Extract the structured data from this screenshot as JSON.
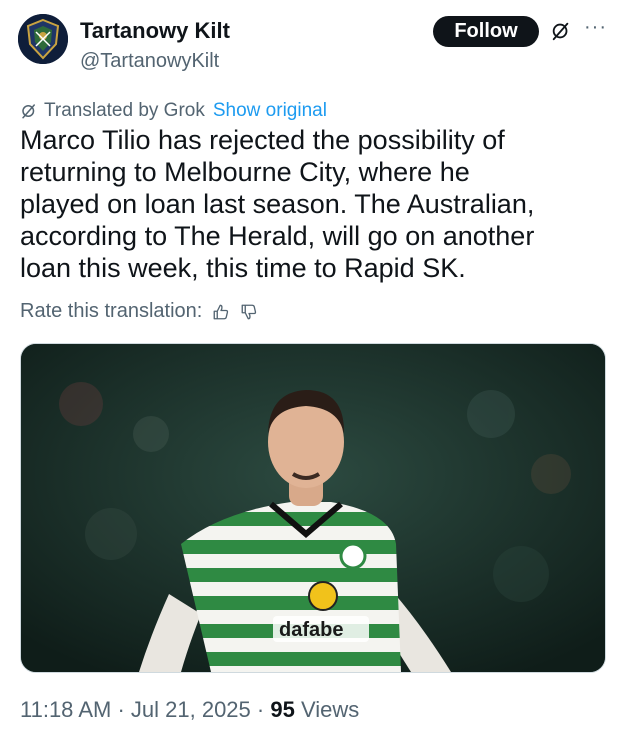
{
  "author": {
    "display_name": "Tartanowy Kilt",
    "handle": "@TartanowyKilt",
    "avatar_icon": "club-crest-icon"
  },
  "actions": {
    "follow_label": "Follow",
    "grok_icon": "grok-icon",
    "more_icon": "more-icon",
    "more_label": "···"
  },
  "translation": {
    "translated_by": "Translated by Grok",
    "show_original": "Show original",
    "rate_label": "Rate this translation:"
  },
  "tweet": {
    "text": "Marco Tilio has rejected the possibility of\nreturning to Melbourne City, where he\nplayed on loan last season. The Australian,\naccording to The Herald, will go on another\nloan this week, this time to Rapid SK."
  },
  "media": {
    "sponsor": "dafabe"
  },
  "meta": {
    "time": "11:18 AM",
    "date": "Jul 21, 2025",
    "views_count": "95",
    "views_label": "Views"
  },
  "colors": {
    "link": "#1d9bf0",
    "muted": "#536471",
    "text": "#0f1419"
  }
}
